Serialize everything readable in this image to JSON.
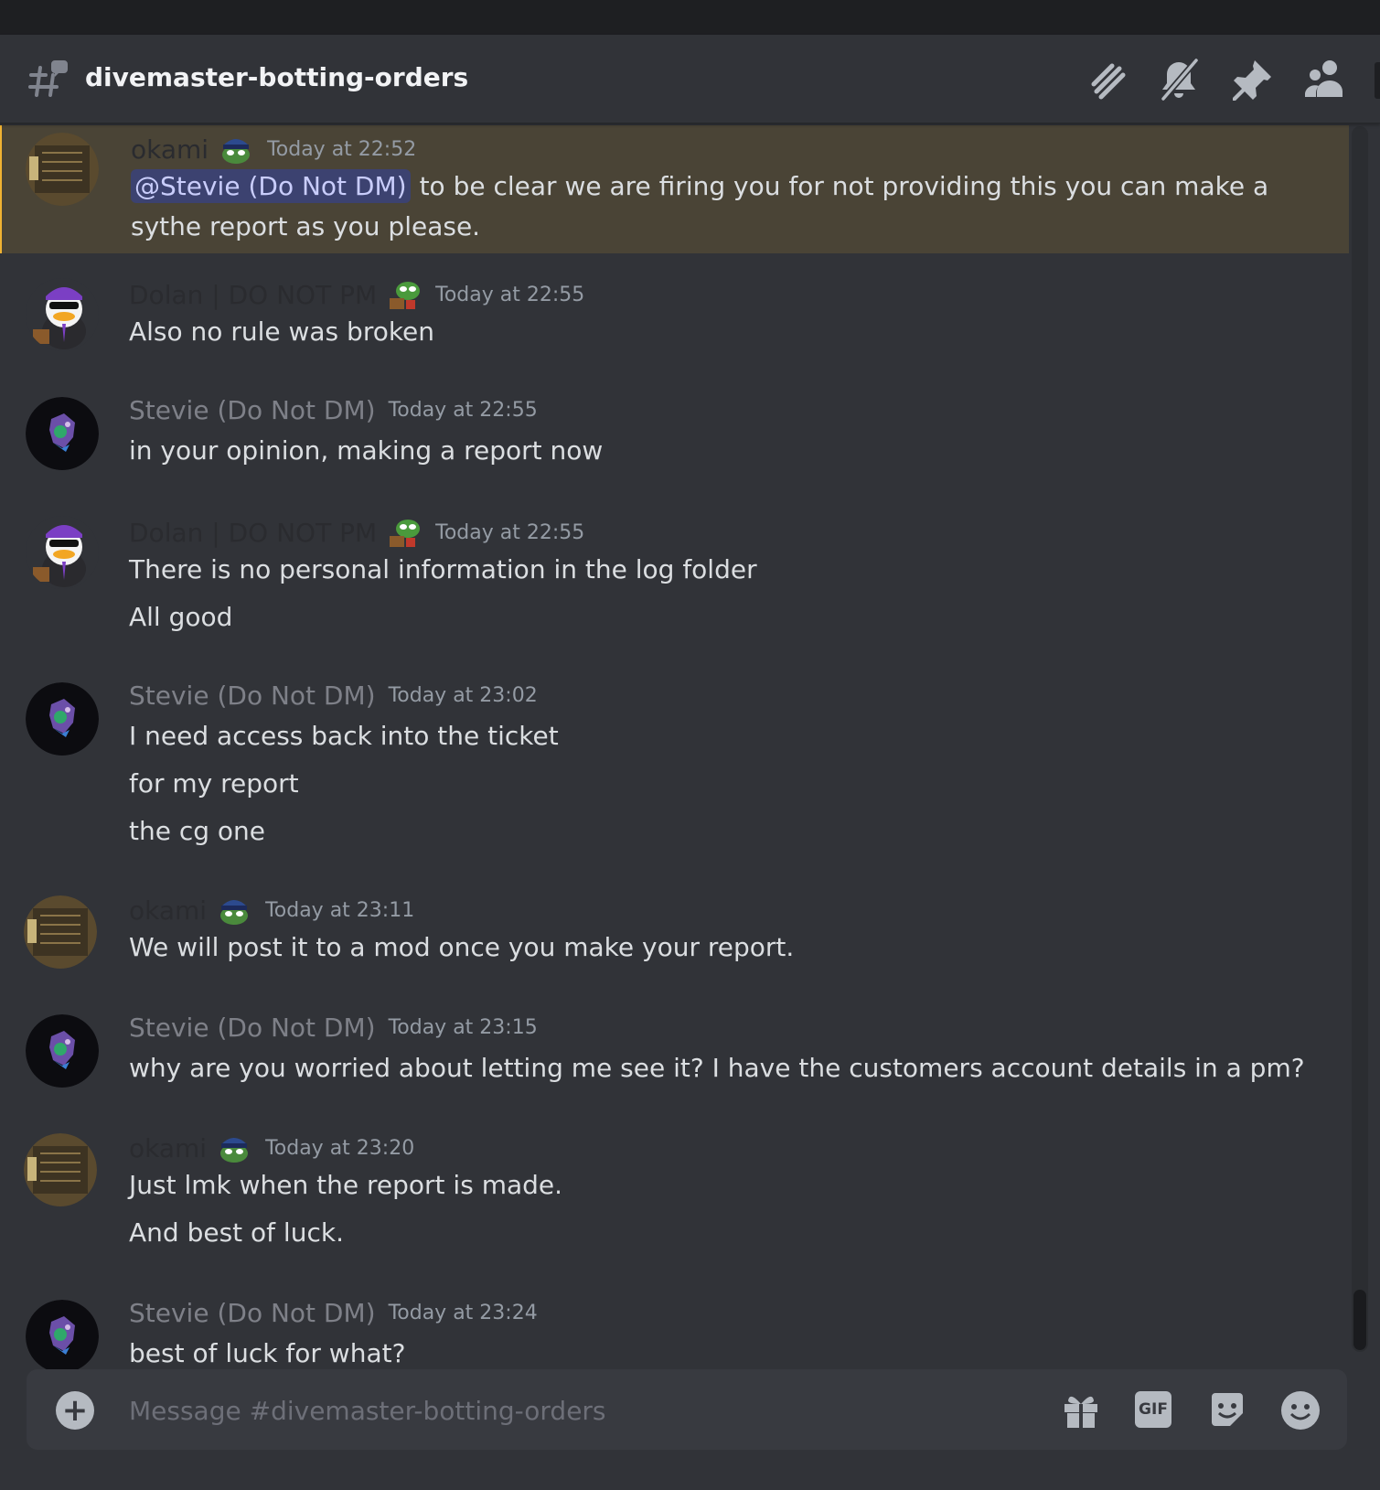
{
  "channel": {
    "name": "divemaster-botting-orders"
  },
  "header_tools": [
    "threads-icon",
    "mute-icon",
    "pin-icon",
    "members-icon"
  ],
  "messages": [
    {
      "author": "okami",
      "time": "Today at 22:52",
      "mention": "@Stevie (Do Not DM)",
      "lines": [
        "to be clear we are firing you for not providing this you can make a",
        "sythe report as you please."
      ]
    },
    {
      "author": "Dolan | DO NOT PM",
      "time": "Today at 22:55",
      "lines": [
        "Also no rule was broken"
      ]
    },
    {
      "author": "Stevie (Do Not DM)",
      "time": "Today at 22:55",
      "lines": [
        "in your opinion, making a report now"
      ]
    },
    {
      "author": "Dolan | DO NOT PM",
      "time": "Today at 22:55",
      "lines": [
        "There is no personal information in the log folder",
        "All good"
      ]
    },
    {
      "author": "Stevie (Do Not DM)",
      "time": "Today at 23:02",
      "lines": [
        "I need access back into the ticket",
        "for my report",
        "the cg one"
      ]
    },
    {
      "author": "okami",
      "time": "Today at 23:11",
      "lines": [
        "We will post it to a mod once you make your report."
      ]
    },
    {
      "author": "Stevie (Do Not DM)",
      "time": "Today at 23:15",
      "lines": [
        "why are you worried about letting me see it? I have the customers account details in a pm?"
      ]
    },
    {
      "author": "okami",
      "time": "Today at 23:20",
      "lines": [
        "Just lmk when the report is made.",
        "And best of luck."
      ]
    },
    {
      "author": "Stevie (Do Not DM)",
      "time": "Today at 23:24",
      "lines": [
        "best of luck for what?"
      ]
    }
  ],
  "composer": {
    "placeholder": "Message #divemaster-botting-orders",
    "gif_label": "GIF"
  },
  "colors": {
    "background": "#313338",
    "highlight": "#4a4436",
    "mention_bg": "#3c4270",
    "mention_text": "#c9cdfb"
  }
}
